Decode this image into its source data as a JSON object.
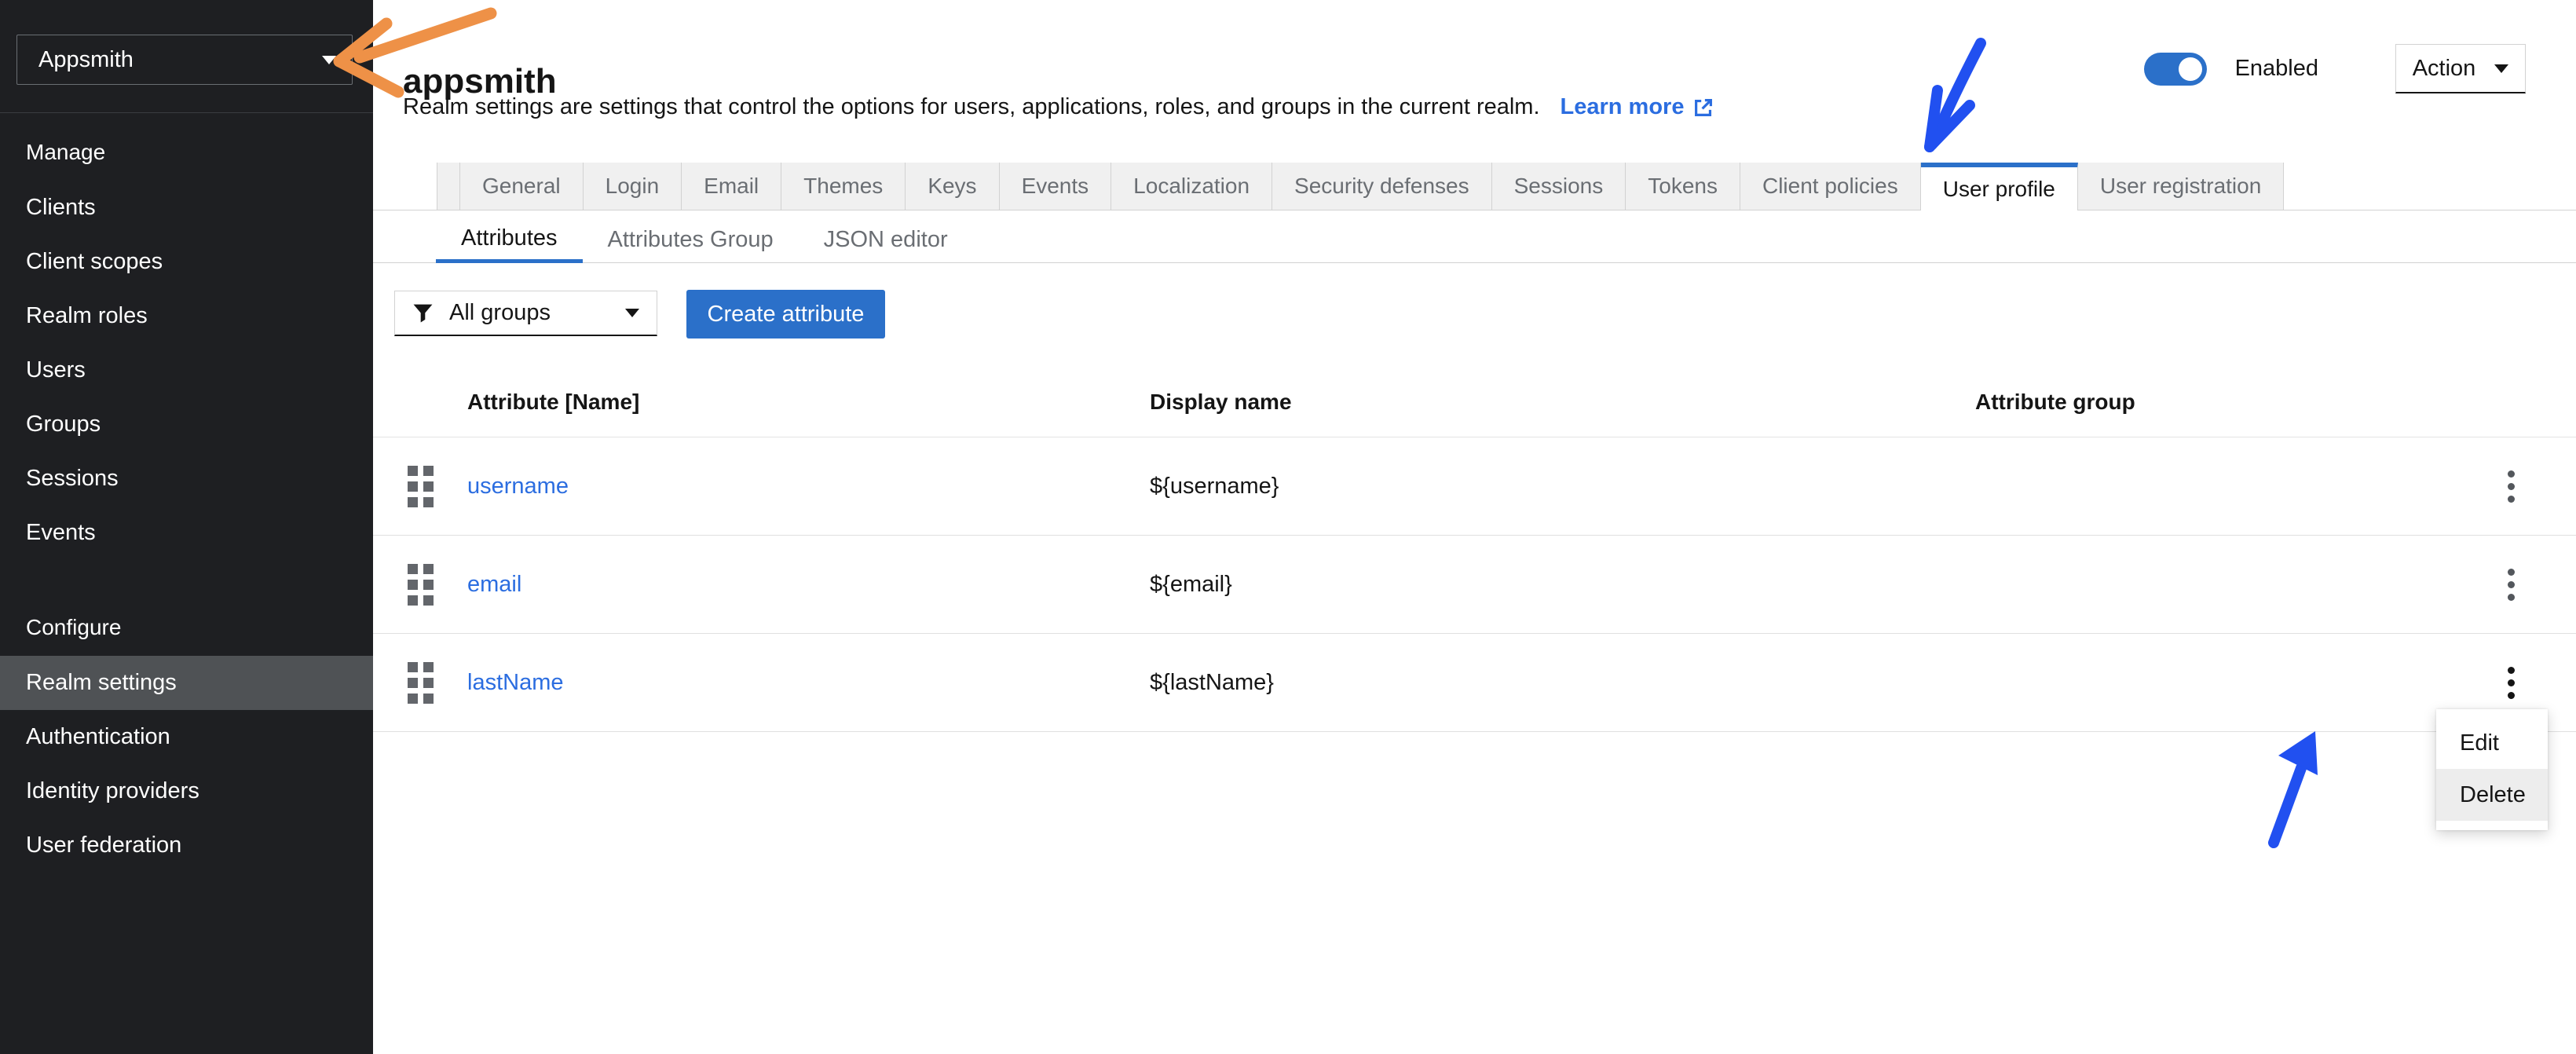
{
  "sidebar": {
    "realm_selector": {
      "label": "Appsmith"
    },
    "sections": [
      {
        "title": "Manage",
        "items": [
          {
            "label": "Clients"
          },
          {
            "label": "Client scopes"
          },
          {
            "label": "Realm roles"
          },
          {
            "label": "Users"
          },
          {
            "label": "Groups"
          },
          {
            "label": "Sessions"
          },
          {
            "label": "Events"
          }
        ]
      },
      {
        "title": "Configure",
        "items": [
          {
            "label": "Realm settings",
            "selected": true
          },
          {
            "label": "Authentication"
          },
          {
            "label": "Identity providers"
          },
          {
            "label": "User federation"
          }
        ]
      }
    ]
  },
  "header": {
    "realm_title": "appsmith",
    "description": "Realm settings are settings that control the options for users, applications, roles, and groups in the current realm.",
    "learn_more_label": "Learn more",
    "enabled_label": "Enabled",
    "enabled_state": "on",
    "action_label": "Action"
  },
  "tabs": {
    "active": "User profile",
    "items": [
      {
        "label": "General"
      },
      {
        "label": "Login"
      },
      {
        "label": "Email"
      },
      {
        "label": "Themes"
      },
      {
        "label": "Keys"
      },
      {
        "label": "Events"
      },
      {
        "label": "Localization"
      },
      {
        "label": "Security defenses"
      },
      {
        "label": "Sessions"
      },
      {
        "label": "Tokens"
      },
      {
        "label": "Client policies"
      },
      {
        "label": "User profile",
        "active": true
      },
      {
        "label": "User registration"
      }
    ]
  },
  "subtabs": {
    "active": "Attributes",
    "items": [
      {
        "label": "Attributes",
        "active": true
      },
      {
        "label": "Attributes Group"
      },
      {
        "label": "JSON editor"
      }
    ]
  },
  "toolbar": {
    "group_filter_value": "All groups",
    "create_button_label": "Create attribute"
  },
  "attributes_table": {
    "columns": [
      "Attribute [Name]",
      "Display name",
      "Attribute group"
    ],
    "rows": [
      {
        "name": "username",
        "display_name": "${username}",
        "attribute_group": ""
      },
      {
        "name": "email",
        "display_name": "${email}",
        "attribute_group": ""
      },
      {
        "name": "lastName",
        "display_name": "${lastName}",
        "attribute_group": ""
      }
    ]
  },
  "context_menu": {
    "items": [
      {
        "label": "Edit"
      },
      {
        "label": "Delete",
        "highlighted": true
      }
    ]
  },
  "colors": {
    "accent_blue": "#2b70c9",
    "link_blue": "#2b6de0",
    "annotation_blue": "#2150f0",
    "annotation_orange": "#ee9147",
    "sidebar_bg": "#1e1f22",
    "sidebar_selected_bg": "#4f5255",
    "tab_bg": "#f0f0f0"
  }
}
